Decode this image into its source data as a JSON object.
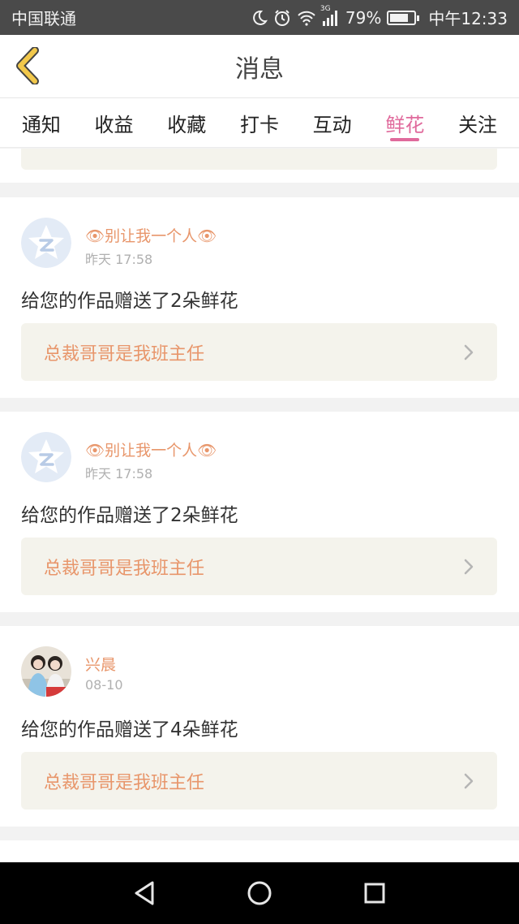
{
  "status_bar": {
    "carrier": "中国联通",
    "network": "3G",
    "battery_percent": "79%",
    "battery_level": 0.79,
    "time": "中午12:33"
  },
  "header": {
    "title": "消息",
    "back_icon": "chevron-left-icon"
  },
  "tabs": [
    {
      "label": "通知",
      "active": false
    },
    {
      "label": "收益",
      "active": false
    },
    {
      "label": "收藏",
      "active": false
    },
    {
      "label": "打卡",
      "active": false
    },
    {
      "label": "互动",
      "active": false
    },
    {
      "label": "鲜花",
      "active": true
    },
    {
      "label": "关注",
      "active": false
    }
  ],
  "messages": [
    {
      "username": "👁别让我一个人👁",
      "time": "昨天 17:58",
      "text": "给您的作品赠送了2朵鲜花",
      "work_title": "总裁哥哥是我班主任",
      "avatar": "default-avatar-icon"
    },
    {
      "username": "👁别让我一个人👁",
      "time": "昨天 17:58",
      "text": "给您的作品赠送了2朵鲜花",
      "work_title": "总裁哥哥是我班主任",
      "avatar": "default-avatar-icon"
    },
    {
      "username": "兴晨",
      "time": "08-10",
      "text": "给您的作品赠送了4朵鲜花",
      "work_title": "总裁哥哥是我班主任",
      "avatar": "user-photo-avatar"
    }
  ],
  "colors": {
    "accent_pink": "#e06a9c",
    "name_orange": "#e8966b",
    "work_bg": "#f4f3ec",
    "back_icon_yellow": "#f2c84b"
  }
}
